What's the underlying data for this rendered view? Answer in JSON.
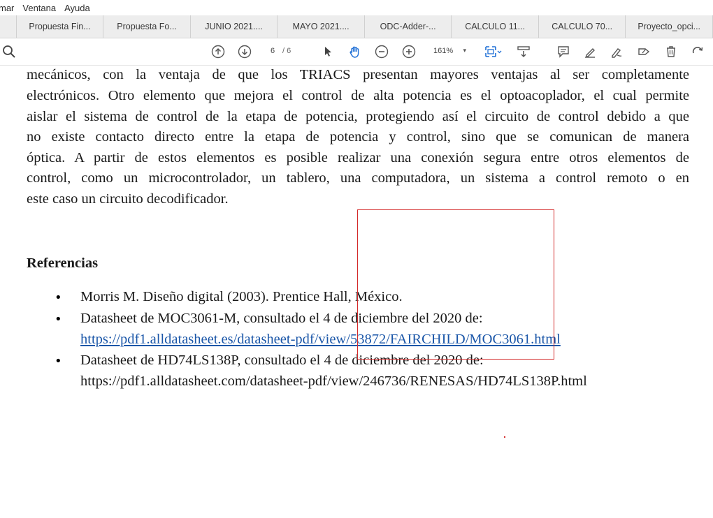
{
  "menubar": {
    "items": [
      "mar",
      "Ventana",
      "Ayuda"
    ]
  },
  "tabs": [
    "",
    "Propuesta Fin...",
    "Propuesta Fo...",
    "JUNIO 2021....",
    "MAYO 2021....",
    "ODC-Adder-...",
    "CALCULO 11...",
    "CALCULO 70...",
    "Proyecto_opci..."
  ],
  "toolbar": {
    "page_current": "6",
    "page_total": "/ 6",
    "zoom": "161%",
    "icons": [
      "search-icon",
      "page-up-icon",
      "page-down-icon",
      "select-pointer-icon",
      "hand-tool-icon",
      "zoom-out-icon",
      "zoom-in-icon",
      "fit-page-icon",
      "scroll-mode-icon",
      "comment-icon",
      "highlight-icon",
      "draw-icon",
      "fill-sign-icon",
      "delete-icon",
      "rotate-icon"
    ]
  },
  "document": {
    "paragraph_lines": [
      "mecánicos, con la ventaja de que los TRIACS presentan mayores ventajas al ser completamente",
      "electrónicos. Otro elemento que mejora el control de alta potencia es el optoacoplador, el cual permite",
      "aislar el sistema de control de la etapa de potencia, protegiendo así el circuito de control debido a que",
      "no existe contacto directo entre la etapa de potencia y control, sino que se comunican de manera",
      "óptica. A partir de estos elementos es posible realizar una conexión segura entre otros elementos de",
      "control, como un microcontrolador, un tablero, una computadora, un sistema a control remoto o en",
      "este caso un circuito decodificador."
    ],
    "references_heading": "Referencias",
    "references": [
      {
        "bullet": "•",
        "lines": [
          "Morris M. Diseño digital (2003). Prentice Hall, México."
        ]
      },
      {
        "bullet": "•",
        "lines": [
          "Datasheet de MOC3061-M, consultado el 4 de diciembre del 2020 de:",
          "https://pdf1.alldatasheet.es/datasheet-pdf/view/53872/FAIRCHILD/MOC3061.html"
        ]
      },
      {
        "bullet": "•",
        "lines": [
          "Datasheet de HD74LS138P, consultado el 4 de diciembre del 2020 de:",
          "https://pdf1.alldatasheet.com/datasheet-pdf/view/246736/RENESAS/HD74LS138P.html"
        ]
      }
    ]
  },
  "colors": {
    "annotation": "#d42a2a",
    "link": "#1a56a8",
    "accent_icon": "#1f6fd6"
  }
}
